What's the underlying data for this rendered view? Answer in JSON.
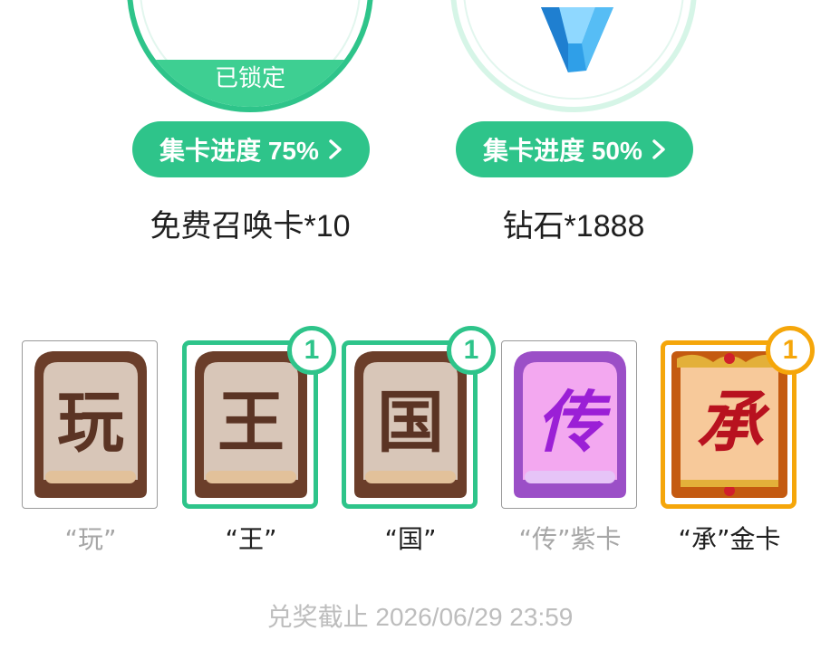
{
  "prizes": [
    {
      "status": "已锁定",
      "progress_label": "集卡进度 75%",
      "progress_percent": 75,
      "name": "免费召唤卡*10",
      "icon": "summon-card-icon"
    },
    {
      "progress_label": "集卡进度 50%",
      "progress_percent": 50,
      "name": "钻石*1888",
      "icon": "diamond-icon"
    }
  ],
  "cards": [
    {
      "glyph": "玩",
      "label": "“玩”",
      "count": null,
      "collected": false
    },
    {
      "glyph": "王",
      "label": "“王”",
      "count": "1",
      "collected": true
    },
    {
      "glyph": "国",
      "label": "“国”",
      "count": "1",
      "collected": true
    },
    {
      "glyph": "传",
      "label": "“传”紫卡",
      "count": null,
      "collected": false
    },
    {
      "glyph": "承",
      "label": "“承”金卡",
      "count": "1",
      "collected": true
    }
  ],
  "deadline": "兑奖截止 2026/06/29 23:59",
  "colors": {
    "accent": "#2ec48a",
    "gold": "#f5a60a",
    "text": "#1f1f1f",
    "muted": "#a6a6a6"
  }
}
